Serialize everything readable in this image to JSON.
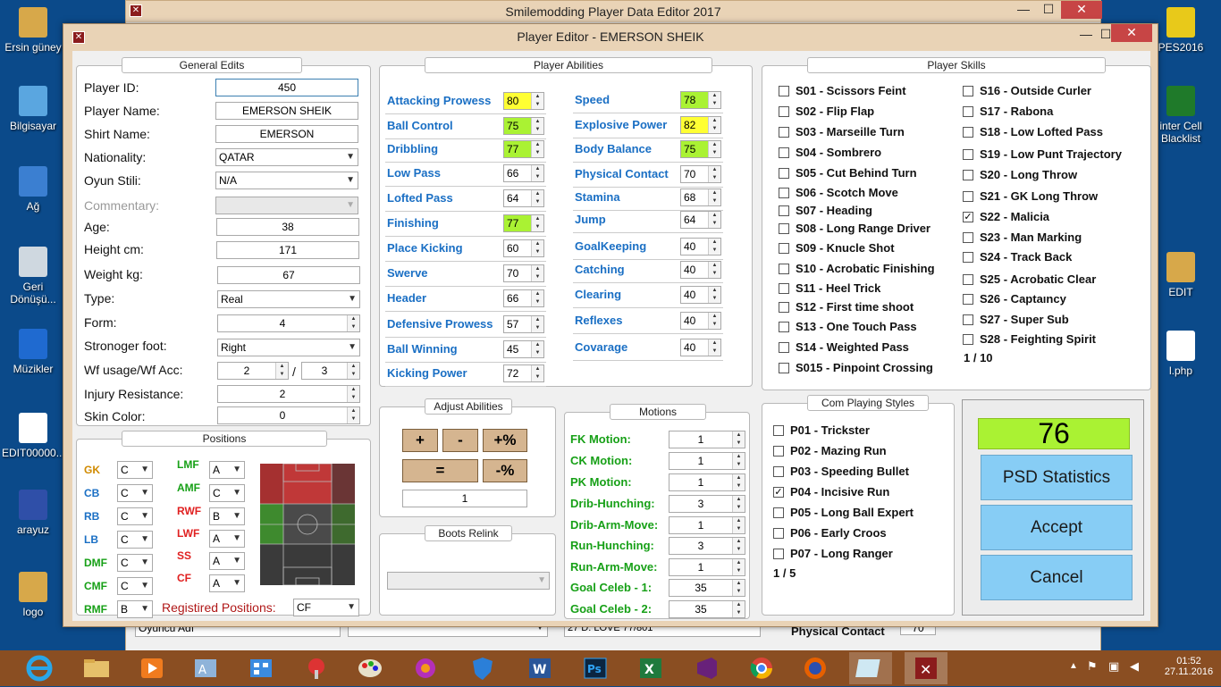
{
  "desktop_icons": [
    {
      "label": "Ersin güney",
      "color": "#d7a84a"
    },
    {
      "label": "Bilgisayar",
      "color": "#5aa6e0"
    },
    {
      "label": "Ağ",
      "color": "#3b7fd1"
    },
    {
      "label": "Geri Dönüşü...",
      "color": "#cfd8e0"
    },
    {
      "label": "Müzikler",
      "color": "#1f6ad0"
    },
    {
      "label": "EDIT00000...",
      "color": "#ffffff"
    },
    {
      "label": "arayuz",
      "color": "#2f4fa8"
    },
    {
      "label": "logo",
      "color": "#d7a84a"
    }
  ],
  "desktop_icons_right": [
    {
      "label": "PES2016",
      "color": "#e8c91a"
    },
    {
      "label": "inter Cell Blacklist",
      "color": "#1f7a2a"
    },
    {
      "label": "EDIT",
      "color": "#d7a84a"
    },
    {
      "label": "l.php",
      "color": "#ffffff"
    }
  ],
  "outer_window": {
    "title": "Smilemodding Player Data Editor 2017",
    "minimize": "—",
    "maximize": "☐",
    "close": "✕"
  },
  "inner_window": {
    "title": "Player Editor - EMERSON SHEIK",
    "minimize": "—",
    "maximize": "☐",
    "close": "✕"
  },
  "general": {
    "title": "General Edits",
    "player_id_label": "Player ID:",
    "player_id": "450",
    "player_name_label": "Player Name:",
    "player_name": "EMERSON SHEIK",
    "shirt_name_label": "Shirt Name:",
    "shirt_name": "EMERSON",
    "nationality_label": "Nationality:",
    "nationality": "QATAR",
    "style_label": "Oyun Stili:",
    "style": "N/A",
    "commentary_label": "Commentary:",
    "age_label": "Age:",
    "age": "38",
    "height_label": "Height cm:",
    "height": "171",
    "weight_label": "Weight kg:",
    "weight": "67",
    "type_label": "Type:",
    "type": "Real",
    "form_label": "Form:",
    "form": "4",
    "foot_label": "Stronoger foot:",
    "foot": "Right",
    "wf_label": "Wf usage/Wf Acc:",
    "wf_usage": "2",
    "wf_slash": "/",
    "wf_acc": "3",
    "injury_label": "Injury Resistance:",
    "injury": "2",
    "skin_label": "Skin Color:",
    "skin": "0"
  },
  "positions": {
    "title": "Positions",
    "left": [
      {
        "pos": "GK",
        "val": "C",
        "color": "#d08a00"
      },
      {
        "pos": "CB",
        "val": "C",
        "color": "#1a6fc4"
      },
      {
        "pos": "RB",
        "val": "C",
        "color": "#1a6fc4"
      },
      {
        "pos": "LB",
        "val": "C",
        "color": "#1a6fc4"
      },
      {
        "pos": "DMF",
        "val": "C",
        "color": "#17a017"
      },
      {
        "pos": "CMF",
        "val": "C",
        "color": "#17a017"
      },
      {
        "pos": "RMF",
        "val": "B",
        "color": "#17a017"
      }
    ],
    "right": [
      {
        "pos": "LMF",
        "val": "A",
        "color": "#17a017"
      },
      {
        "pos": "AMF",
        "val": "C",
        "color": "#17a017"
      },
      {
        "pos": "RWF",
        "val": "B",
        "color": "#e02020"
      },
      {
        "pos": "LWF",
        "val": "A",
        "color": "#e02020"
      },
      {
        "pos": "SS",
        "val": "A",
        "color": "#e02020"
      },
      {
        "pos": "CF",
        "val": "A",
        "color": "#e02020"
      }
    ],
    "registered_label": "Registired Positions:",
    "registered": "CF"
  },
  "abilities": {
    "title": "Player Abilities",
    "left": [
      {
        "label": "Attacking Prowess",
        "value": "80",
        "hl": "#ffff33"
      },
      {
        "label": "Ball Control",
        "value": "75",
        "hl": "#aaf233"
      },
      {
        "label": "Dribbling",
        "value": "77",
        "hl": "#aaf233"
      },
      {
        "label": "Low Pass",
        "value": "66",
        "hl": ""
      },
      {
        "label": "Lofted Pass",
        "value": "64",
        "hl": ""
      },
      {
        "label": "Finishing",
        "value": "77",
        "hl": "#aaf233"
      },
      {
        "label": "Place Kicking",
        "value": "60",
        "hl": ""
      },
      {
        "label": "Swerve",
        "value": "70",
        "hl": ""
      },
      {
        "label": "Header",
        "value": "66",
        "hl": ""
      },
      {
        "label": "Defensive Prowess",
        "value": "57",
        "hl": ""
      },
      {
        "label": "Ball Winning",
        "value": "45",
        "hl": ""
      },
      {
        "label": "Kicking Power",
        "value": "72",
        "hl": ""
      }
    ],
    "right": [
      {
        "label": "Speed",
        "value": "78",
        "hl": "#aaf233"
      },
      {
        "label": "Explosive Power",
        "value": "82",
        "hl": "#ffff33"
      },
      {
        "label": "Body Balance",
        "value": "75",
        "hl": "#aaf233"
      },
      {
        "label": "Physical Contact",
        "value": "70",
        "hl": ""
      },
      {
        "label": "Stamina",
        "value": "68",
        "hl": ""
      },
      {
        "label": "Jump",
        "value": "64",
        "hl": ""
      },
      {
        "label": "GoalKeeping",
        "value": "40",
        "hl": ""
      },
      {
        "label": "Catching",
        "value": "40",
        "hl": ""
      },
      {
        "label": "Clearing",
        "value": "40",
        "hl": ""
      },
      {
        "label": "Reflexes",
        "value": "40",
        "hl": ""
      },
      {
        "label": "Covarage",
        "value": "40",
        "hl": ""
      }
    ]
  },
  "skills": {
    "title": "Player Skills",
    "col1": [
      {
        "label": "S01 - Scissors Feint",
        "checked": false
      },
      {
        "label": "S02 - Flip Flap",
        "checked": false
      },
      {
        "label": "S03 - Marseille Turn",
        "checked": false
      },
      {
        "label": "S04 - Sombrero",
        "checked": false
      },
      {
        "label": "S05 - Cut Behind  Turn",
        "checked": false
      },
      {
        "label": "S06 - Scotch Move",
        "checked": false
      },
      {
        "label": "S07 - Heading",
        "checked": false
      },
      {
        "label": "S08 - Long Range Driver",
        "checked": false
      },
      {
        "label": "S09 - Knucle Shot",
        "checked": false
      },
      {
        "label": "S10 - Acrobatic Finishing",
        "checked": false
      },
      {
        "label": "S11 - Heel Trick",
        "checked": false
      },
      {
        "label": "S12 - First time shoot",
        "checked": false
      },
      {
        "label": "S13 - One Touch Pass",
        "checked": false
      },
      {
        "label": "S14 - Weighted Pass",
        "checked": false
      },
      {
        "label": "S015 - Pinpoint Crossing",
        "checked": false
      }
    ],
    "col2": [
      {
        "label": "S16 - Outside Curler",
        "checked": false
      },
      {
        "label": "S17 - Rabona",
        "checked": false
      },
      {
        "label": "S18 - Low Lofted Pass",
        "checked": false
      },
      {
        "label": "S19 - Low Punt Trajectory",
        "checked": false
      },
      {
        "label": "S20 - Long Throw",
        "checked": false
      },
      {
        "label": "S21 - GK Long Throw",
        "checked": false
      },
      {
        "label": "S22 - Malicia",
        "checked": true
      },
      {
        "label": "S23 - Man Marking",
        "checked": false
      },
      {
        "label": "S24 - Track Back",
        "checked": false
      },
      {
        "label": "S25 - Acrobatic Clear",
        "checked": false
      },
      {
        "label": "S26 - Captaıncy",
        "checked": false
      },
      {
        "label": "S27 - Super Sub",
        "checked": false
      },
      {
        "label": "S28 - Feighting Spirit",
        "checked": false
      }
    ],
    "count": "1 / 10"
  },
  "adjust": {
    "title": "Adjust Abilities",
    "plus": "+",
    "minus": "-",
    "plus_pct": "+%",
    "equals": "=",
    "minus_pct": "-%",
    "value": "1"
  },
  "boots": {
    "title": "Boots Relink"
  },
  "motions": {
    "title": "Motions",
    "items": [
      {
        "label": "FK Motion:",
        "value": "1"
      },
      {
        "label": "CK Motion:",
        "value": "1"
      },
      {
        "label": "PK Motion:",
        "value": "1"
      },
      {
        "label": "Drib-Hunching:",
        "value": "3"
      },
      {
        "label": "Drib-Arm-Move:",
        "value": "1"
      },
      {
        "label": "Run-Hunching:",
        "value": "3"
      },
      {
        "label": "Run-Arm-Move:",
        "value": "1"
      },
      {
        "label": "Goal Celeb  - 1:",
        "value": "35"
      },
      {
        "label": "Goal Celeb  - 2:",
        "value": "35"
      }
    ]
  },
  "com_styles": {
    "title": "Com Playing Styles",
    "items": [
      {
        "label": "P01 - Trickster",
        "checked": false
      },
      {
        "label": "P02 - Mazing Run",
        "checked": false
      },
      {
        "label": "P03 - Speeding Bullet",
        "checked": false
      },
      {
        "label": "P04 - Incisive Run",
        "checked": true
      },
      {
        "label": "P05 - Long Ball Expert",
        "checked": false
      },
      {
        "label": "P06 - Early Croos",
        "checked": false
      },
      {
        "label": "P07 - Long Ranger",
        "checked": false
      }
    ],
    "count": "1 / 5"
  },
  "summary": {
    "overall": "76",
    "psd": "PSD Statistics",
    "accept": "Accept",
    "cancel": "Cancel"
  },
  "behind_row": {
    "left": "Oyuncu Adı",
    "mid": "27  D. LOVE     77/801",
    "label": "Physical Contact",
    "value": "70"
  },
  "tray": {
    "time": "01:52",
    "date": "27.11.2016"
  }
}
